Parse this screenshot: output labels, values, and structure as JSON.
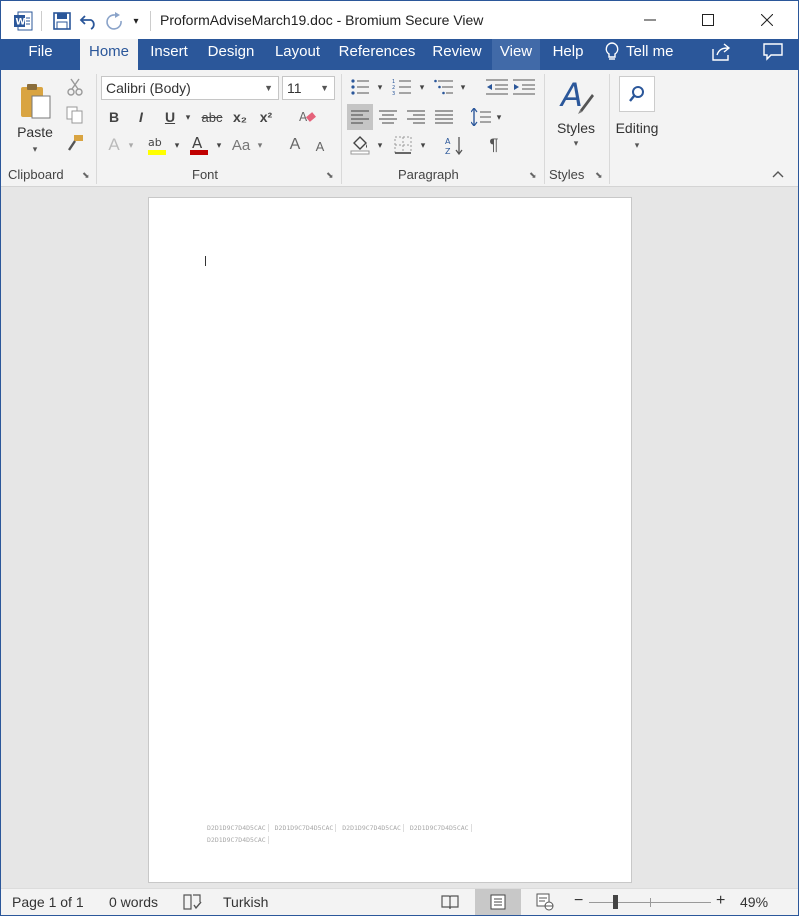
{
  "window": {
    "title": "ProformAdviseMarch19.doc - Bromium Secure View",
    "accent": "#2b579a"
  },
  "quick_access": {
    "app_icon": "word-icon",
    "save_icon": "save-icon",
    "undo_icon": "undo-icon",
    "redo_icon": "redo-icon",
    "customize_icon": "customize-qat-icon"
  },
  "tabs": [
    {
      "label": "File"
    },
    {
      "label": "Home"
    },
    {
      "label": "Insert"
    },
    {
      "label": "Design"
    },
    {
      "label": "Layout"
    },
    {
      "label": "References"
    },
    {
      "label": "Review"
    },
    {
      "label": "View"
    },
    {
      "label": "Help"
    },
    {
      "label": "Tell me"
    }
  ],
  "active_tab": "Home",
  "ribbon": {
    "clipboard": {
      "label": "Clipboard",
      "paste_label": "Paste"
    },
    "font": {
      "label": "Font",
      "font_name": "Calibri (Body)",
      "font_size": "11",
      "bold": "B",
      "italic": "I",
      "underline": "U",
      "strike": "abc",
      "sub": "x₂",
      "sup": "x²",
      "change_case": "Aa",
      "grow": "A",
      "shrink": "A",
      "highlight_color": "#ffff00",
      "font_color": "#c00000"
    },
    "paragraph": {
      "label": "Paragraph",
      "show_marks": "¶"
    },
    "styles": {
      "label": "Styles",
      "button_label": "Styles"
    },
    "editing": {
      "button_label": "Editing"
    }
  },
  "document": {
    "footer_codes": [
      "D2D1D9C7D4D5CAC",
      "D2D1D9C7D4D5CAC",
      "D2D1D9C7D4D5CAC",
      "D2D1D9C7D4D5CAC",
      "D2D1D9C7D4D5CAC"
    ]
  },
  "status": {
    "page": "Page 1 of 1",
    "words": "0 words",
    "language": "Turkish",
    "zoom": "49%",
    "zoom_minus": "−",
    "zoom_plus": "+",
    "zoom_level": 0.49
  }
}
